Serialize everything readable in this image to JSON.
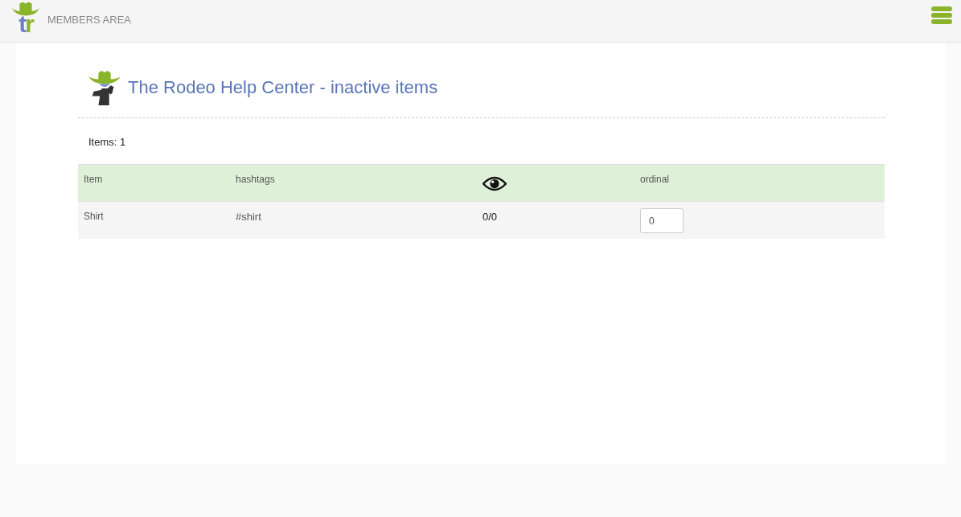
{
  "header": {
    "logo_text": "tr",
    "title": "MEMBERS AREA"
  },
  "page": {
    "title": "The Rodeo Help Center - inactive items",
    "count": "Items: 1"
  },
  "table": {
    "columns": [
      {
        "kind": "text",
        "label": "Item"
      },
      {
        "kind": "text",
        "label": "hashtags"
      },
      {
        "kind": "icon"
      },
      {
        "kind": "text",
        "label": "ordinal"
      }
    ],
    "rows": [
      {
        "item": "Shirt",
        "hashtags": "#shirt",
        "views": "0/0",
        "ordinal": "0"
      }
    ]
  }
}
